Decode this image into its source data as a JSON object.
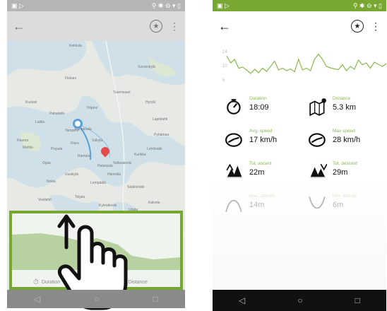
{
  "left_phone": {
    "map_labels": [
      "Kekkula",
      "Vuorenkylä",
      "Fiskars",
      "Kustavi",
      "Tuomisaari",
      "Hyrylä",
      "Ylöjärvi",
      "Pahalahti",
      "Lapinlahti",
      "Laitila",
      "Rauma",
      "Mattila",
      "Lehtimäki",
      "Kangasala",
      "Pyhämaa",
      "Säkylä",
      "Kurikka",
      "Kiuru",
      "Valkeakoski",
      "Tampere",
      "Rantala",
      "Ojala",
      "Pispala",
      "Hatanpää",
      "Härmälä",
      "Uusikylä",
      "Nokia",
      "Lempäälä",
      "Sääksmäki",
      "Toijala",
      "Vesilahti",
      "Kylmäkoski",
      "Urjala",
      "Kalvola",
      "Viiala",
      "Akaa",
      "Kuru",
      "Hämeenkyrö"
    ],
    "peek_labels": {
      "duration": "Duration",
      "distance": "Distance"
    }
  },
  "right_phone": {
    "elevation": {
      "y_ticks": [
        "14",
        "10",
        "6"
      ],
      "profile": [
        13,
        11,
        12,
        9.5,
        9.8,
        9,
        8,
        9.2,
        8.2,
        9.5,
        8.6,
        10,
        11.5,
        9,
        9.5,
        8.8,
        9.3,
        8.5,
        12,
        9,
        9.5,
        8.8,
        12,
        13.5,
        12,
        10,
        9.6,
        9.3,
        9.1,
        10.5,
        8.8,
        10,
        9.2,
        11.8,
        10.5,
        11,
        9.5,
        11.2,
        10.6,
        10,
        10.8
      ]
    },
    "stats": [
      {
        "label": "Duration",
        "value": "18:09",
        "icon": "stopwatch-icon"
      },
      {
        "label": "Distance",
        "value": "5.3 km",
        "icon": "map-pin-icon"
      },
      {
        "label": "Avg. speed",
        "value": "17 km/h",
        "icon": "speedometer-icon"
      },
      {
        "label": "Max speed",
        "value": "28 km/h",
        "icon": "speedometer-icon"
      },
      {
        "label": "Tot. ascent",
        "value": "22m",
        "icon": "ascent-icon"
      },
      {
        "label": "Tot. descent",
        "value": "29m",
        "icon": "descent-icon"
      },
      {
        "label": "Max. altitude",
        "value": "14m",
        "icon": "max-altitude-icon"
      },
      {
        "label": "Min. altitude",
        "value": "6m",
        "icon": "min-altitude-icon"
      }
    ]
  },
  "colors": {
    "accent_green": "#78a832",
    "label_green": "#8ab84e",
    "route_blue": "#5aa0d8",
    "pin_red": "#e34b4b"
  }
}
